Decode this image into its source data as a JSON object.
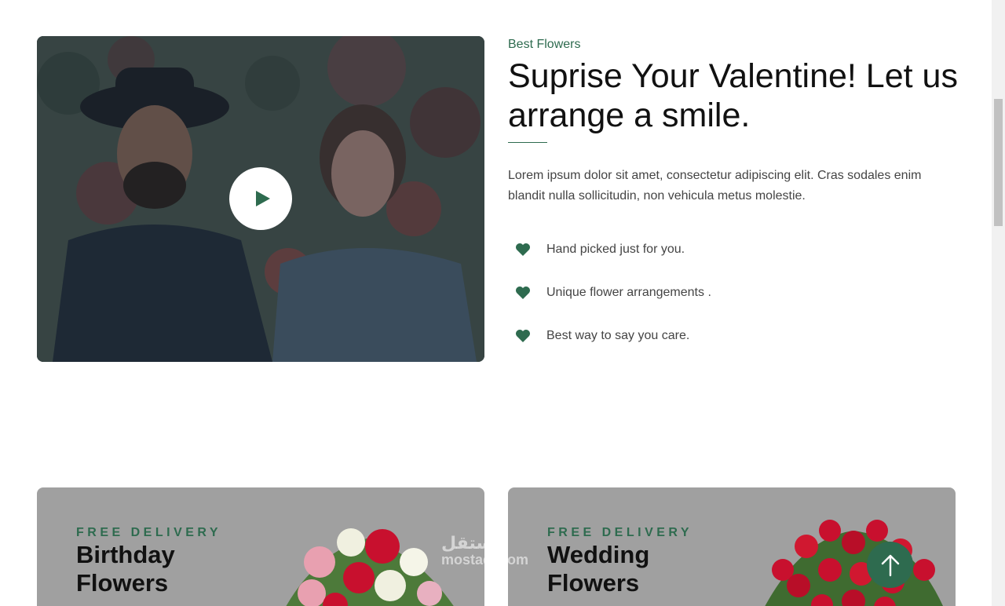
{
  "about": {
    "subtitle": "Best Flowers",
    "headline": "Suprise Your Valentine! Let us arrange a smile.",
    "lead": "Lorem ipsum dolor sit amet, consectetur adipiscing elit. Cras sodales enim blandit nulla sollicitudin, non vehicula metus molestie.",
    "features": [
      {
        "icon": "heart-icon",
        "text": "Hand picked just for you."
      },
      {
        "icon": "heart-icon",
        "text": "Unique flower arrangements ."
      },
      {
        "icon": "heart-icon",
        "text": "Best way to say you care."
      }
    ],
    "video": {
      "icon": "play-icon"
    }
  },
  "promos": [
    {
      "eyebrow": "FREE DELIVERY",
      "title": "Birthday Flowers"
    },
    {
      "eyebrow": "FREE DELIVERY",
      "title": "Wedding Flowers"
    }
  ],
  "watermark": {
    "line1": "مستقل",
    "line2": "mostaql.com"
  },
  "back_to_top": {
    "icon": "arrow-up-icon"
  },
  "colors": {
    "accent": "#2e6b4f",
    "promo_bg": "#a0a0a0",
    "text": "#444444"
  }
}
